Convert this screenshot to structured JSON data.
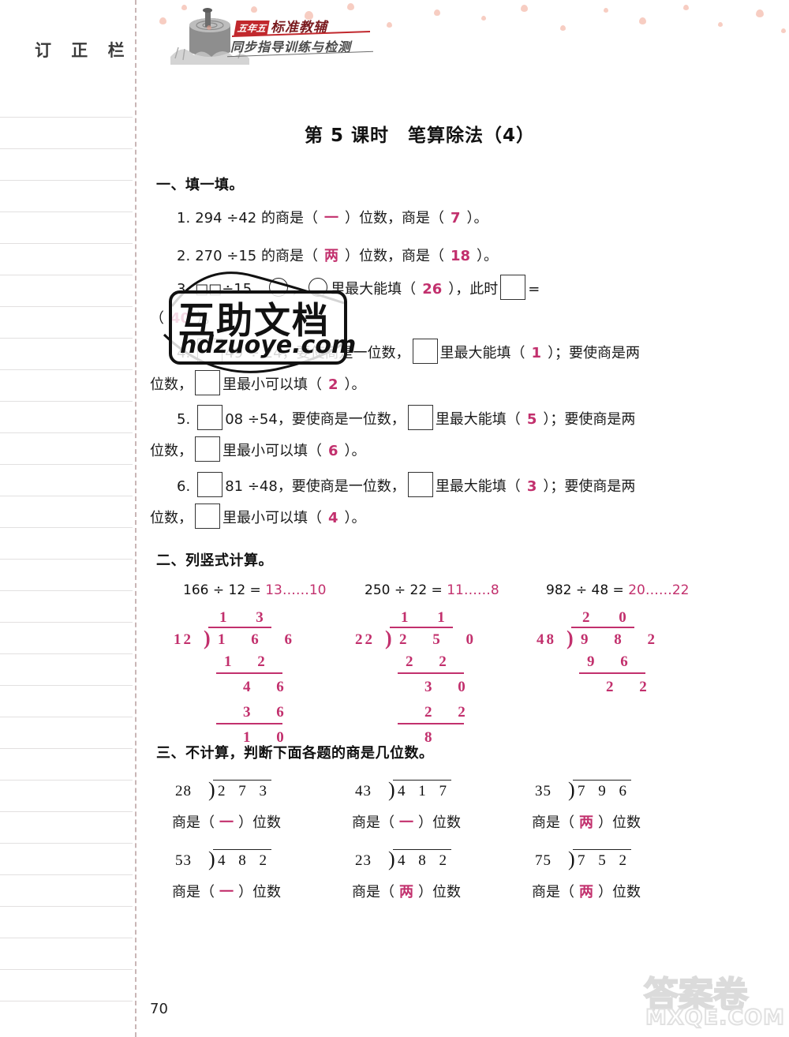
{
  "sidebar": {
    "title": "订 正 栏",
    "rule_count": 29
  },
  "header": {
    "brand_tag": "五年五",
    "brand_line1": "标准教辅",
    "brand_line2": "同步指导训练与检测"
  },
  "lesson": {
    "title": "第 5 课时　笔算除法（4）"
  },
  "section1": {
    "heading": "一、填一填。",
    "items": [
      {
        "num": "1.",
        "pre": "294 ÷42 的商是（",
        "a1": "一",
        "mid": "）位数，商是（",
        "a2": "7",
        "post": "）。"
      },
      {
        "num": "2.",
        "pre": "270 ÷15 的商是（",
        "a1": "两",
        "mid": "）位数，商是（",
        "a2": "18",
        "post": "）。"
      },
      {
        "num": "3.",
        "pre": "□□ ÷ 15 ",
        "a1": "26",
        "mid": "里最大能填（",
        "a2": "40",
        "post": "，○里最大能填（26），此时 □ = （40）。"
      }
    ],
    "item3": {
      "num": "3.",
      "hidden_left": "□□÷15",
      "dots": "…",
      "mid": "，",
      "tail": "里最大能填（",
      "ans_max": "26",
      "tail2": "），此时",
      "eqsign": "=",
      "tail3": "（",
      "ans_eq": "40",
      "tail4": "）。"
    },
    "item4": {
      "num": "4.",
      "expr": "49 ÷ 24",
      "t1": "，要使商是一位数，",
      "t2": "里最大能填（",
      "a1": "1",
      "t3": "）；要使商是两",
      "t4": "位数，",
      "t5": "里最小可以填（",
      "a2": "2",
      "t6": "）。"
    },
    "item5": {
      "num": "5.",
      "expr": "08 ÷54",
      "t1": "，要使商是一位数，",
      "t2": "里最大能填（",
      "a1": "5",
      "t3": "）；要使商是两",
      "t4": "位数，",
      "t5": "里最小可以填（",
      "a2": "6",
      "t6": "）。"
    },
    "item6": {
      "num": "6.",
      "expr": "81 ÷48",
      "t1": "，要使商是一位数，",
      "t2": "里最大能填（",
      "a1": "3",
      "t3": "）；要使商是两",
      "t4": "位数，",
      "t5": "里最小可以填（",
      "a2": "4",
      "t6": "）。"
    }
  },
  "section2": {
    "heading": "二、列竖式计算。",
    "problems": [
      {
        "eq_left": "166 ÷ 12 = ",
        "eq_ans": "13……10",
        "divisor": "12",
        "quotient": "1 3",
        "dividend": "1 6 6",
        "steps": [
          "1 2",
          "4 6",
          "3 6",
          "1 0"
        ]
      },
      {
        "eq_left": "250 ÷ 22 = ",
        "eq_ans": "11……8",
        "divisor": "22",
        "quotient": "1 1",
        "dividend": "2 5 0",
        "steps": [
          "2 2",
          "3 0",
          "2 2",
          "8"
        ]
      },
      {
        "eq_left": "982 ÷ 48 = ",
        "eq_ans": "20……22",
        "divisor": "48",
        "quotient": "2 0",
        "dividend": "9 8 2",
        "steps": [
          "9 6",
          "2 2"
        ]
      }
    ]
  },
  "section3": {
    "heading": "三、不计算，判断下面各题的商是几位数。",
    "label_pre": "商是（",
    "label_post": "）位数",
    "items": [
      {
        "divisor": "28",
        "dividend": "2 7 3",
        "answer": "一"
      },
      {
        "divisor": "43",
        "dividend": "4 1 7",
        "answer": "一"
      },
      {
        "divisor": "35",
        "dividend": "7 9 6",
        "answer": "两"
      },
      {
        "divisor": "53",
        "dividend": "4 8 2",
        "answer": "一"
      },
      {
        "divisor": "23",
        "dividend": "4 8 2",
        "answer": "两"
      },
      {
        "divisor": "75",
        "dividend": "7 5 2",
        "answer": "两"
      }
    ]
  },
  "watermarks": {
    "center_cn": "互助文档",
    "center_en": "hdzuoye.com",
    "bottom_cn": "答案卷",
    "bottom_en": "MXQE.COM"
  },
  "page_number": "70",
  "colors": {
    "answer_pink": "#c2306d",
    "brand_red": "#c1282d",
    "dash_line": "#c9b6b6",
    "heart": "#f0a48f"
  }
}
